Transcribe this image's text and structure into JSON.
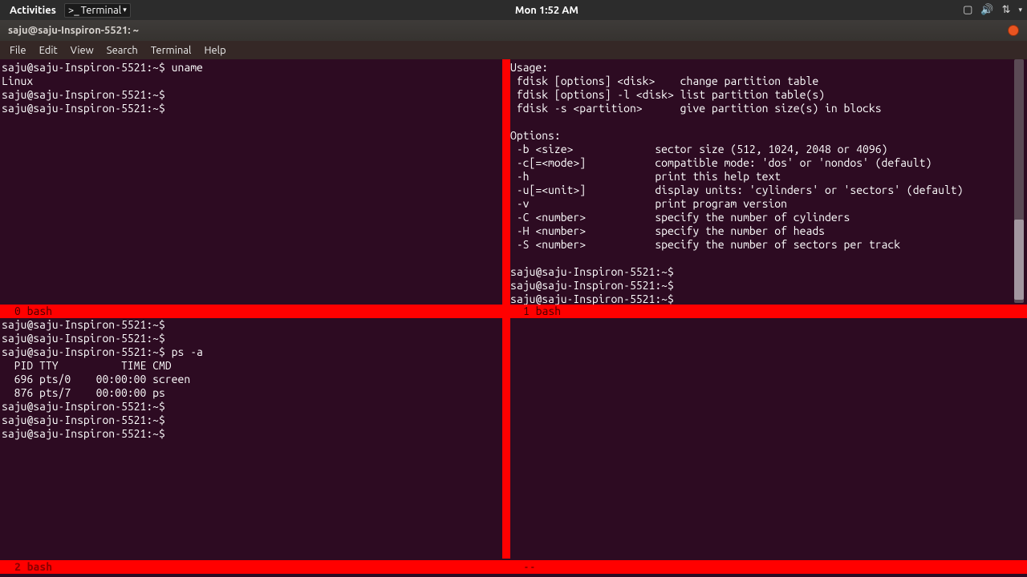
{
  "topbar": {
    "activities": "Activities",
    "app_label": "Terminal",
    "clock": "Mon  1:52 AM"
  },
  "titlebar": {
    "title": "saju@saju-Inspiron-5521: ~"
  },
  "menubar": {
    "file": "File",
    "edit": "Edit",
    "view": "View",
    "search": "Search",
    "terminal": "Terminal",
    "help": "Help"
  },
  "panes": {
    "tl": "saju@saju-Inspiron-5521:~$ uname\nLinux\nsaju@saju-Inspiron-5521:~$ \nsaju@saju-Inspiron-5521:~$ ",
    "tr": "Usage:\n fdisk [options] <disk>    change partition table\n fdisk [options] -l <disk> list partition table(s)\n fdisk -s <partition>      give partition size(s) in blocks\n\nOptions:\n -b <size>             sector size (512, 1024, 2048 or 4096)\n -c[=<mode>]           compatible mode: 'dos' or 'nondos' (default)\n -h                    print this help text\n -u[=<unit>]           display units: 'cylinders' or 'sectors' (default)\n -v                    print program version\n -C <number>           specify the number of cylinders\n -H <number>           specify the number of heads\n -S <number>           specify the number of sectors per track\n\nsaju@saju-Inspiron-5521:~$ \nsaju@saju-Inspiron-5521:~$ \nsaju@saju-Inspiron-5521:~$ ",
    "bl": "saju@saju-Inspiron-5521:~$ \nsaju@saju-Inspiron-5521:~$ \nsaju@saju-Inspiron-5521:~$ ps -a\n  PID TTY          TIME CMD\n  696 pts/0    00:00:00 screen\n  876 pts/7    00:00:00 ps\nsaju@saju-Inspiron-5521:~$ \nsaju@saju-Inspiron-5521:~$ \nsaju@saju-Inspiron-5521:~$ ",
    "br": ""
  },
  "captions": {
    "c0": "0 bash",
    "c1": "1 bash",
    "c2": "2 bash",
    "c3": "--"
  }
}
